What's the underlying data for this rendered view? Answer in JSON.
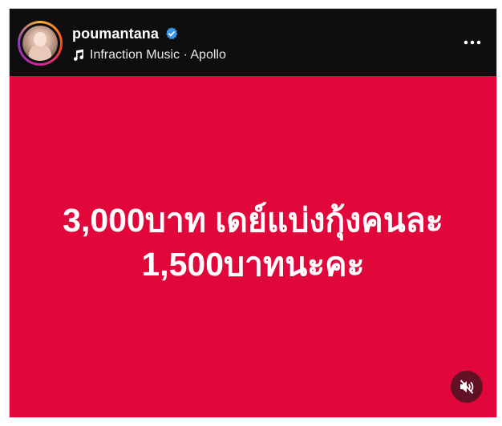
{
  "header": {
    "username": "poumantana",
    "verified": true,
    "music": {
      "artist": "Infraction Music",
      "separator": "·",
      "track": "Apollo",
      "text": "Infraction Music · Apollo"
    },
    "icons": {
      "verified": "verified-badge-icon",
      "music": "music-note-icon",
      "more": "more-options-icon"
    }
  },
  "post": {
    "background_color": "#e2073a",
    "caption_lines": [
      "3,000บาท เดย์แบ่งกุ้งคนละ",
      "1,500บาทนะคะ"
    ],
    "mute_icon": "speaker-muted-icon"
  },
  "colors": {
    "header_bg": "#0e0e0e",
    "verified_blue": "#3897f0",
    "text_white": "#ffffff"
  }
}
